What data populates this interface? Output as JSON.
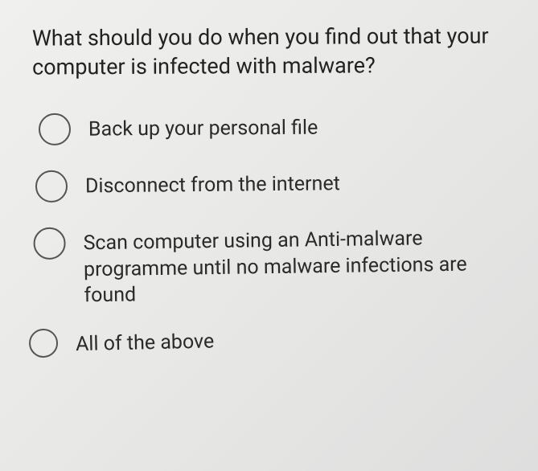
{
  "question": "What should you do when you find out that your computer is infected with malware?",
  "options": [
    {
      "label": "Back up your personal file"
    },
    {
      "label": "Disconnect from the internet"
    },
    {
      "label": "Scan computer using an Anti-malware programme until no malware infections are found"
    },
    {
      "label": "All of the above"
    }
  ]
}
